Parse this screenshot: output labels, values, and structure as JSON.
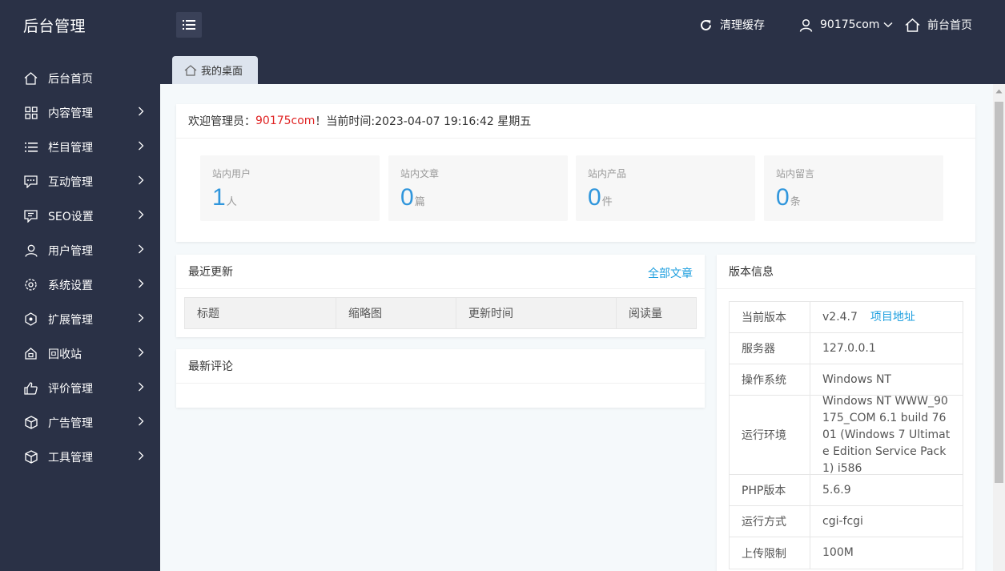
{
  "header": {
    "brand": "后台管理",
    "clear_cache": "清理缓存",
    "username": "90175com",
    "frontend_home": "前台首页"
  },
  "sidebar": {
    "items": [
      {
        "label": "后台首页",
        "icon": "home-icon",
        "has_arrow": false
      },
      {
        "label": "内容管理",
        "icon": "grid-icon",
        "has_arrow": true
      },
      {
        "label": "栏目管理",
        "icon": "list-icon",
        "has_arrow": true
      },
      {
        "label": "互动管理",
        "icon": "chat-icon",
        "has_arrow": true
      },
      {
        "label": "SEO设置",
        "icon": "seo-chat-icon",
        "has_arrow": true
      },
      {
        "label": "用户管理",
        "icon": "user-icon",
        "has_arrow": true
      },
      {
        "label": "系统设置",
        "icon": "gear-icon",
        "has_arrow": true
      },
      {
        "label": "扩展管理",
        "icon": "extension-icon",
        "has_arrow": true
      },
      {
        "label": "回收站",
        "icon": "recycle-icon",
        "has_arrow": true
      },
      {
        "label": "评价管理",
        "icon": "thumb-up-icon",
        "has_arrow": true
      },
      {
        "label": "广告管理",
        "icon": "cube-icon",
        "has_arrow": true
      },
      {
        "label": "工具管理",
        "icon": "cube-icon",
        "has_arrow": true
      }
    ]
  },
  "tabs": [
    {
      "label": "我的桌面",
      "active": true
    }
  ],
  "welcome": {
    "prefix": "欢迎管理员：",
    "admin": "90175com",
    "suffix": "！当前时间:2023-04-07 19:16:42 星期五"
  },
  "stats": [
    {
      "label": "站内用户",
      "value": "1",
      "unit": "人"
    },
    {
      "label": "站内文章",
      "value": "0",
      "unit": "篇"
    },
    {
      "label": "站内产品",
      "value": "0",
      "unit": "件"
    },
    {
      "label": "站内留言",
      "value": "0",
      "unit": "条"
    }
  ],
  "recent": {
    "title": "最近更新",
    "more": "全部文章",
    "columns": [
      "标题",
      "缩略图",
      "更新时间",
      "阅读量"
    ]
  },
  "comments": {
    "title": "最新评论"
  },
  "version": {
    "title": "版本信息",
    "project_link": "项目地址",
    "rows": [
      {
        "key": "当前版本",
        "value": "v2.4.7"
      },
      {
        "key": "服务器",
        "value": "127.0.0.1"
      },
      {
        "key": "操作系统",
        "value": "Windows NT"
      },
      {
        "key": "运行环境",
        "value": "Windows NT WWW_90175_COM 6.1 build 7601 (Windows 7 Ultimate Edition Service Pack 1) i586"
      },
      {
        "key": "PHP版本",
        "value": "5.6.9"
      },
      {
        "key": "运行方式",
        "value": "cgi-fcgi"
      },
      {
        "key": "上传限制",
        "value": "100M"
      }
    ]
  },
  "colors": {
    "sidebar_bg": "#2a3146",
    "accent_blue": "#3096dc",
    "link_blue": "#1e9fdf",
    "admin_red": "#e02424"
  }
}
